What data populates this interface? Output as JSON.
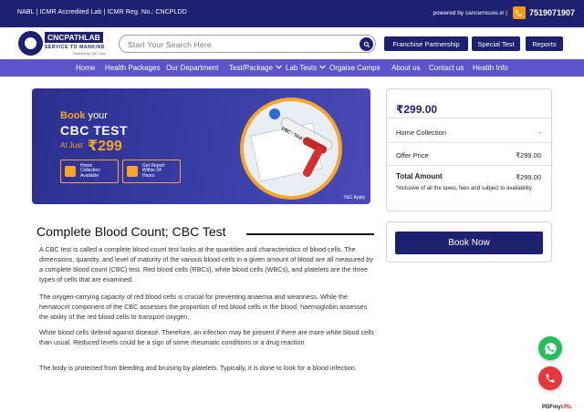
{
  "topbar": {
    "accreditation": "NABL | ICMR Accredited Lab | ICMR Reg. No.: CNCPLDD",
    "powered": "powered by cancerncure.in |",
    "phone": "7519071907",
    "phone_icon": "phone-icon"
  },
  "header": {
    "logo_brand_a": "CNC",
    "logo_brand_b": "PATHLAB",
    "logo_tagline": "SERVICE TO MANKIND",
    "logo_small": "Powered by CNC Care",
    "search_placeholder": "Start Your Search Here",
    "franchise": "Franchise Partnership",
    "special_test": "Special Test",
    "reports": "Reports"
  },
  "nav": {
    "items": [
      "Home",
      "Health Packages",
      "Our Department",
      "Test/Package",
      "Lab Tests",
      "Orgaise Camps",
      "About us",
      "Contact us",
      "Health Info"
    ]
  },
  "banner": {
    "book": "Book",
    "your": "your",
    "test_name": "CBC TEST",
    "at_just": "At Just",
    "price": "₹299",
    "feature_home": "Home Collection Available",
    "feature_report": "Get Report Within 24 Hours",
    "tube_label": "CBC - Test",
    "tc": "T&C Apply"
  },
  "price_card": {
    "price": "₹299.00",
    "home_collection_label": "Home Collection",
    "home_collection_value": "-",
    "offer_label": "Offer Price",
    "offer_value": "₹299.00",
    "total_label": "Total Amount",
    "total_value": "₹299.00",
    "note": "*inclusive of all the taxes, fees and subject to availability"
  },
  "book_now": "Book Now",
  "content": {
    "title": "Complete Blood Count; CBC Test",
    "p1": "A CBC test is called a complete blood count test looks at the quantities and characteristics of blood cells. The dimensions, quantity, and level of maturity of the various blood cells in a given amount of blood are all measured by a complete blood count (CBC) test. Red blood cells (RBCs), white blood cells (WBCs), and platelets are the three types of cells that are examined.",
    "p2": "The oxygen-carrying capacity of red blood cells is crucial for preventing anaemia and weariness. While the hematocrit component of the CBC assesses the proportion of red blood cells in the blood, haemoglobin assesses the ability of the red blood cells to transport oxygen.",
    "p3": "White blood cells defend against disease. Therefore, an infection may be present if there are more white blood cells than usual. Reduced levels could be a sign of some rheumatic conditions or a drug reaction.",
    "p4": "The body is protected from bleeding and bruising by platelets. Typically, it is done to look for a blood infection."
  },
  "floating": {
    "whatsapp_icon": "whatsapp-icon",
    "call_icon": "call-icon"
  },
  "watermark": {
    "a": "PDFmy",
    "b": "URL"
  },
  "colors": {
    "primary_navy": "#1e2070",
    "nav_purple": "#5d54c9",
    "accent_orange": "#f7a626",
    "whatsapp_green": "#25c05a",
    "call_red": "#e5373f"
  }
}
